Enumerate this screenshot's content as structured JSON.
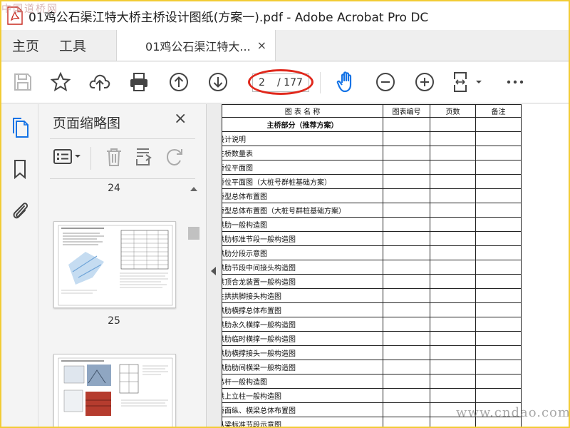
{
  "window": {
    "title": "01鸡公石渠江特大桥主桥设计图纸(方案一).pdf - Adobe Acrobat Pro DC",
    "watermark_top": "中国道桥网",
    "watermark_bottom": "www.cndao.com"
  },
  "tabs": {
    "home": "主页",
    "tools": "工具",
    "document": "01鸡公石渠江特大...",
    "close_symbol": "×"
  },
  "toolbar": {
    "current_page": "2",
    "total_pages": "/ 177",
    "icons": [
      "save-icon",
      "star-icon",
      "cloud-upload-icon",
      "print-icon",
      "page-up-icon",
      "page-down-icon",
      "hand-icon",
      "zoom-out-icon",
      "zoom-in-icon",
      "fit-page-icon",
      "more-icon"
    ]
  },
  "panel": {
    "title": "页面缩略图",
    "close_symbol": "×",
    "thumbnails": [
      {
        "label": "24"
      },
      {
        "label": "25"
      }
    ]
  },
  "document": {
    "headers": [
      "图 表 名 称",
      "图表编号",
      "页数",
      "备注"
    ],
    "section": "主桥部分（推荐方案）",
    "rows": [
      "设计说明",
      "主桥数量表",
      "桥位平面图",
      "桥位平面图（大桩号群桩基础方案）",
      "桥型总体布置图",
      "桥型总体布置图（大桩号群桩基础方案）",
      "拱肋一般构造图",
      "拱肋标准节段一般构造图",
      "拱肋分段示意图",
      "拱肋节段中间接头构造图",
      "拱顶合龙装置一般构造图",
      "主拱拱脚接头构造图",
      "拱肋横撑总体布置图",
      "拱肋永久横撑一般构造图",
      "拱肋临时横撑一般构造图",
      "拱肋横撑接头一般构造图",
      "拱肋肋间横梁一般构造图",
      "吊杆一般构造图",
      "拱上立柱一般构造图",
      "桥面纵、横梁总体布置图",
      "纵梁标准节段示意图"
    ]
  },
  "colors": {
    "accent_blue": "#1473e6",
    "highlight_red": "#e0281c",
    "frame_yellow": "#f2cc35"
  }
}
